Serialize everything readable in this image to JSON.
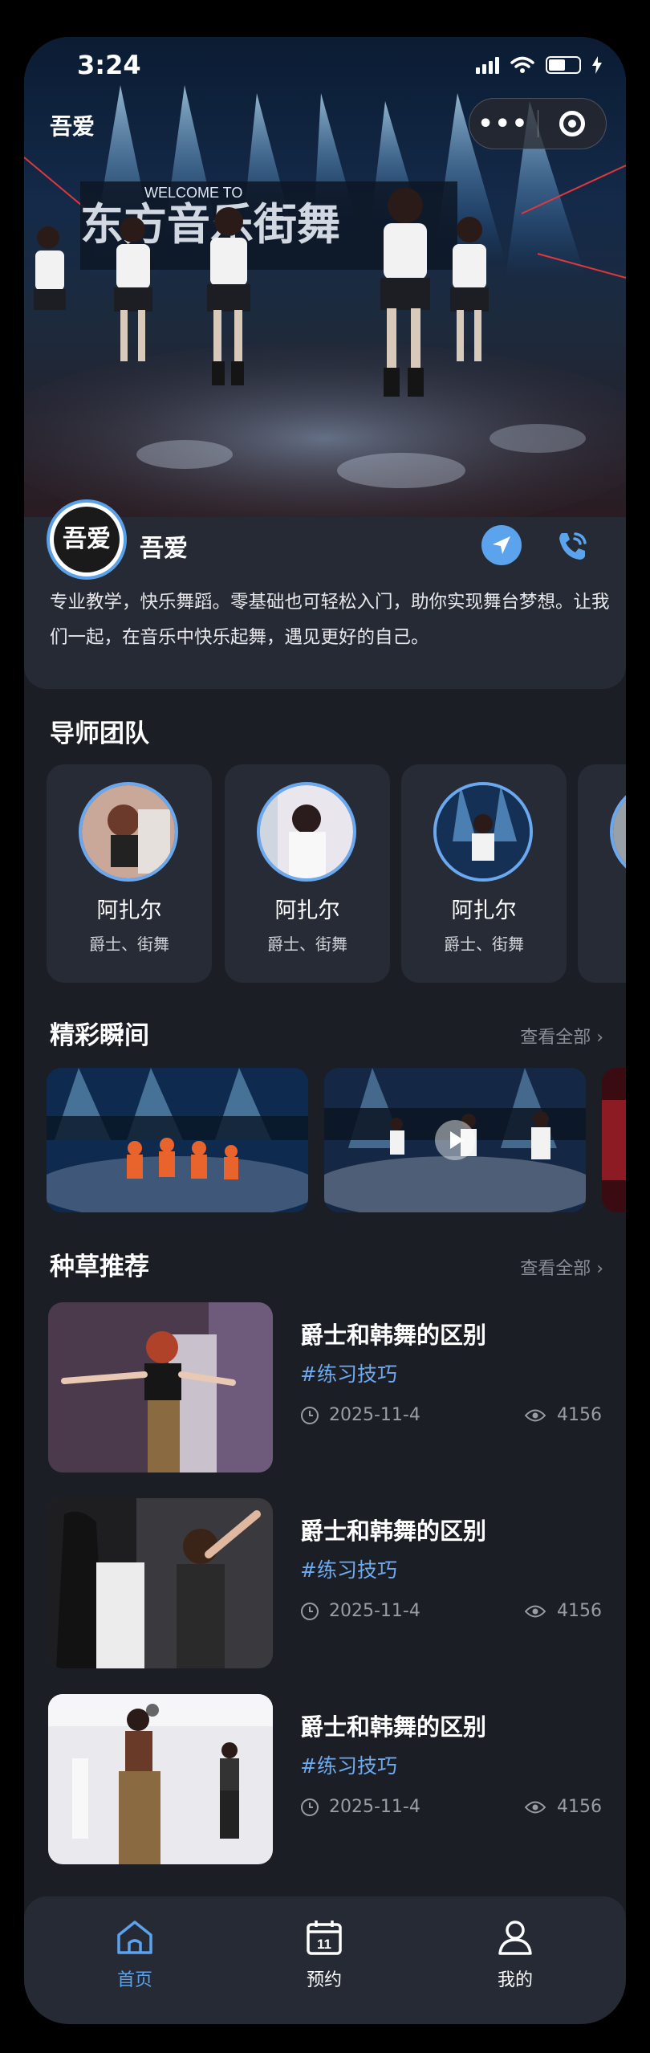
{
  "status_bar": {
    "time": "3:24"
  },
  "header": {
    "title": "吾爱",
    "capsule_more": "•••"
  },
  "hero": {
    "banner_text": "WELCOME TO",
    "banner_name": "东方音乐街舞"
  },
  "studio": {
    "logo_text": "吾爱",
    "name": "吾爱",
    "description": "专业教学，快乐舞蹈。零基础也可轻松入门，助你实现舞台梦想。让我们一起，在音乐中快乐起舞，遇见更好的自己。"
  },
  "mentors": {
    "title": "导师团队",
    "items": [
      {
        "name": "阿扎尔",
        "tags": "爵士、街舞"
      },
      {
        "name": "阿扎尔",
        "tags": "爵士、街舞"
      },
      {
        "name": "阿扎尔",
        "tags": "爵士、街舞"
      },
      {
        "name": "阿",
        "tags": "爵"
      }
    ]
  },
  "moments": {
    "title": "精彩瞬间",
    "see_all": "查看全部 ›"
  },
  "recommend": {
    "title": "种草推荐",
    "see_all": "查看全部 ›",
    "items": [
      {
        "title": "爵士和韩舞的区别",
        "tag": "#练习技巧",
        "date": "2025-11-4",
        "views": "4156"
      },
      {
        "title": "爵士和韩舞的区别",
        "tag": "#练习技巧",
        "date": "2025-11-4",
        "views": "4156"
      },
      {
        "title": "爵士和韩舞的区别",
        "tag": "#练习技巧",
        "date": "2025-11-4",
        "views": "4156"
      }
    ]
  },
  "tabbar": {
    "items": [
      {
        "label": "首页",
        "icon": "home-icon",
        "active": true
      },
      {
        "label": "预约",
        "icon": "calendar-icon",
        "calendar_day": "11",
        "active": false
      },
      {
        "label": "我的",
        "icon": "user-icon",
        "active": false
      }
    ]
  },
  "colors": {
    "accent": "#5ba3ec",
    "background": "#1c1e25",
    "card": "#272b35"
  }
}
